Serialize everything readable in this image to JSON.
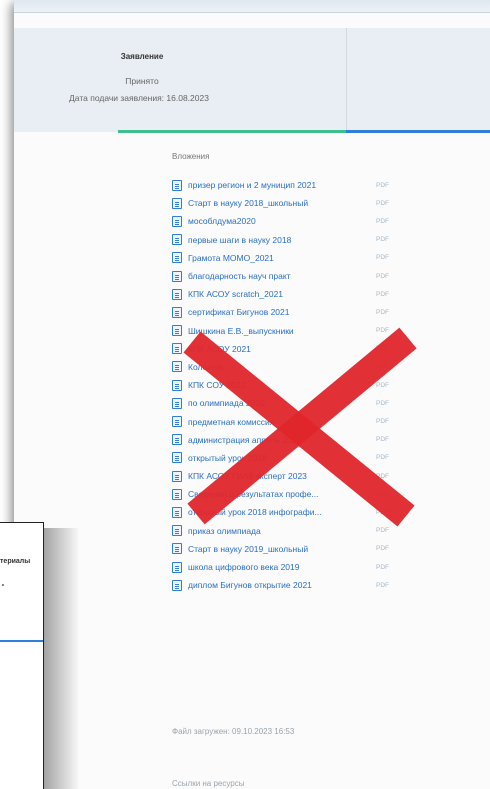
{
  "statement": {
    "title": "Заявление",
    "status": "Принято",
    "date_text": "Дата подачи заявления: 16.08.2023"
  },
  "attachments": {
    "heading": "Вложения",
    "items": [
      {
        "name": "призер регион и 2 муницип 2021",
        "type": "PDF"
      },
      {
        "name": "Старт в науку 2018_школьный",
        "type": "PDF"
      },
      {
        "name": "мособлдума2020",
        "type": "PDF"
      },
      {
        "name": "первые шаги в науку 2018",
        "type": "PDF"
      },
      {
        "name": "Грамота МОМО_2021",
        "type": "PDF"
      },
      {
        "name": "благодарность науч практ",
        "type": "PDF"
      },
      {
        "name": "КПК АСОУ scratch_2021",
        "type": "PDF"
      },
      {
        "name": "сертификат Бигунов 2021",
        "type": "PDF"
      },
      {
        "name": "Шишкина Е.В._выпускники",
        "type": "PDF"
      },
      {
        "name": "КПК АСОУ 2021",
        "type": "PDF"
      },
      {
        "name": "Коломна",
        "type": "PDF"
      },
      {
        "name": "КПК СОУ 2021",
        "type": "PDF"
      },
      {
        "name": "по олимпиада 2020",
        "type": "PDF"
      },
      {
        "name": "предметная комиссия",
        "type": "PDF"
      },
      {
        "name": "администрация апрель 2021",
        "type": "PDF"
      },
      {
        "name": "открытый урок 2018",
        "type": "PDF"
      },
      {
        "name": "КПК АСОУ ГИА9 эксперт 2023",
        "type": "PDF"
      },
      {
        "name": "Сведения о результатах профе...",
        "type": "DOC"
      },
      {
        "name": "открытый урок 2018 инфографи...",
        "type": "PDF"
      },
      {
        "name": "приказ олимпиада",
        "type": "PDF"
      },
      {
        "name": "Старт в науку 2019_школьный",
        "type": "PDF"
      },
      {
        "name": "школа цифрового века 2019",
        "type": "PDF"
      },
      {
        "name": "диплом Бигунов открытие 2021",
        "type": "PDF"
      }
    ]
  },
  "uploaded_text": "Файл загружен: 09.10.2023 16:53",
  "cut_text": "Ссылки на ресурсы",
  "side_panel": {
    "label": "териалы"
  },
  "colors": {
    "link": "#2a6fc4",
    "accent_green": "#3fbf8f",
    "accent_blue": "#2f7ed8",
    "cross_red": "#e0262b"
  }
}
